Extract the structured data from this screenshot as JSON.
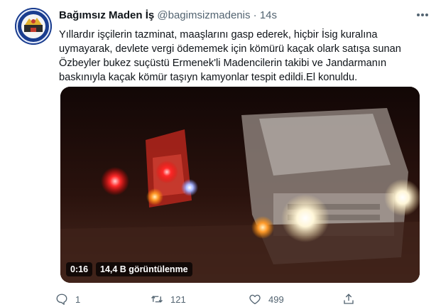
{
  "tweet": {
    "author_name": "Bağımsız Maden İş",
    "author_handle": "@bagimsizmadenis",
    "separator": "·",
    "time": "14s",
    "text_lines": [
      "Yıllardır işçilerin tazminat, maaşlarını gasp ederek, hiçbir İsig kuralına",
      "uymayarak, devlete vergi ödememek için kömürü kaçak olark satışa sunan",
      "Özbeyler bukez suçüstü Ermenek'li Madencilerin takibi ve Jandarmanın",
      "baskınıyla kaçak kömür taşıyn kamyonlar tespit edildi.El konuldu."
    ],
    "media": {
      "type": "video",
      "duration": "0:16",
      "views": "14,4 B görüntülenme"
    },
    "actions": {
      "reply": {
        "icon": "reply-icon",
        "count": "1"
      },
      "retweet": {
        "icon": "retweet-icon",
        "count": "121"
      },
      "like": {
        "icon": "heart-icon",
        "count": "499"
      },
      "share": {
        "icon": "share-icon",
        "count": ""
      }
    }
  },
  "colors": {
    "text_primary": "#0f1419",
    "text_secondary": "#536471",
    "avatar_bg": "#1a3d8f"
  }
}
